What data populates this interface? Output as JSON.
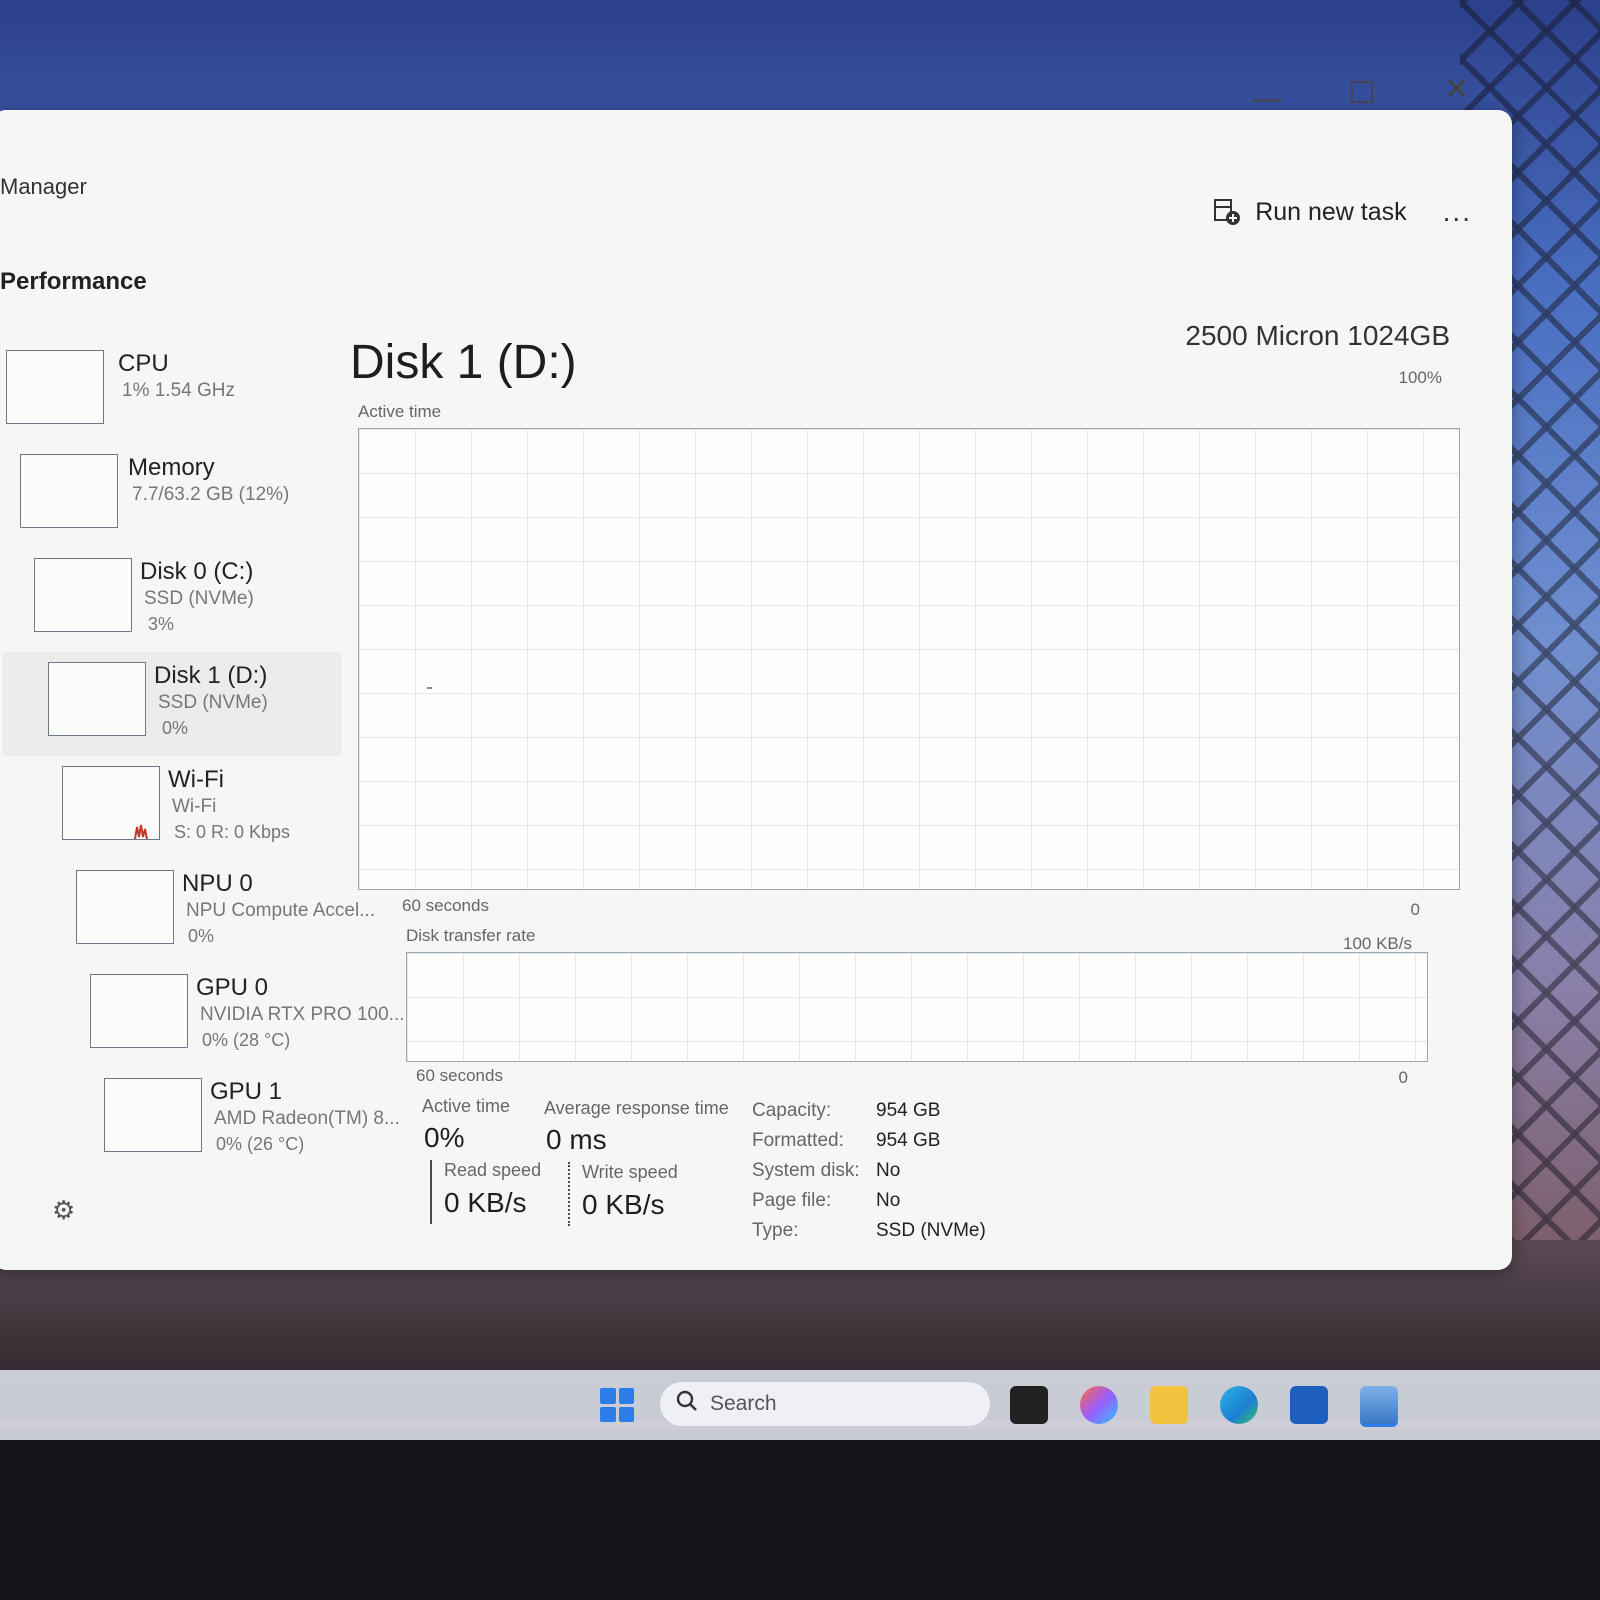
{
  "app": {
    "title": "Manager",
    "window_controls": {
      "minimize": "—",
      "maximize": "☐",
      "close": "✕"
    }
  },
  "command_bar": {
    "run_new_task_label": "Run new task",
    "more_label": "..."
  },
  "page": {
    "heading": "Performance"
  },
  "sidebar": {
    "items": [
      {
        "name": "CPU",
        "sub": "1%  1.54 GHz",
        "sub2": ""
      },
      {
        "name": "Memory",
        "sub": "7.7/63.2 GB (12%)",
        "sub2": ""
      },
      {
        "name": "Disk 0 (C:)",
        "sub": "SSD (NVMe)",
        "sub2": "3%"
      },
      {
        "name": "Disk 1 (D:)",
        "sub": "SSD (NVMe)",
        "sub2": "0%"
      },
      {
        "name": "Wi-Fi",
        "sub": "Wi-Fi",
        "sub2": "S: 0 R: 0 Kbps"
      },
      {
        "name": "NPU 0",
        "sub": "NPU Compute Accel...",
        "sub2": "0%"
      },
      {
        "name": "GPU 0",
        "sub": "NVIDIA RTX PRO 100...",
        "sub2": "0%  (28 °C)"
      },
      {
        "name": "GPU 1",
        "sub": "AMD Radeon(TM) 8...",
        "sub2": "0%  (26 °C)"
      }
    ],
    "selected": "Disk 1 (D:)"
  },
  "detail": {
    "title": "Disk 1 (D:)",
    "model": "2500 Micron 1024GB",
    "active_time_chart": {
      "label": "Active time",
      "max_label": "100%",
      "span_label": "60 seconds",
      "min_label": "0"
    },
    "transfer_chart": {
      "label": "Disk transfer rate",
      "max_label": "100 KB/s",
      "span_label": "60 seconds",
      "min_label": "0"
    },
    "stats": {
      "active_time_label": "Active time",
      "active_time_value": "0%",
      "avg_response_label": "Average response time",
      "avg_response_value": "0 ms",
      "read_speed_label": "Read speed",
      "read_speed_value": "0 KB/s",
      "write_speed_label": "Write speed",
      "write_speed_value": "0 KB/s"
    },
    "info": [
      {
        "key": "Capacity:",
        "value": "954 GB"
      },
      {
        "key": "Formatted:",
        "value": "954 GB"
      },
      {
        "key": "System disk:",
        "value": "No"
      },
      {
        "key": "Page file:",
        "value": "No"
      },
      {
        "key": "Type:",
        "value": "SSD (NVMe)"
      }
    ]
  },
  "taskbar": {
    "search_placeholder": "Search"
  },
  "icons": {
    "run_task": "run-task-icon",
    "settings": "gear-icon",
    "search": "search-icon",
    "start": "windows-start-icon"
  },
  "colors": {
    "accent": "#2b7de9",
    "graph_line": "#6b8fb0",
    "wifi_graph": "#c0392b"
  }
}
